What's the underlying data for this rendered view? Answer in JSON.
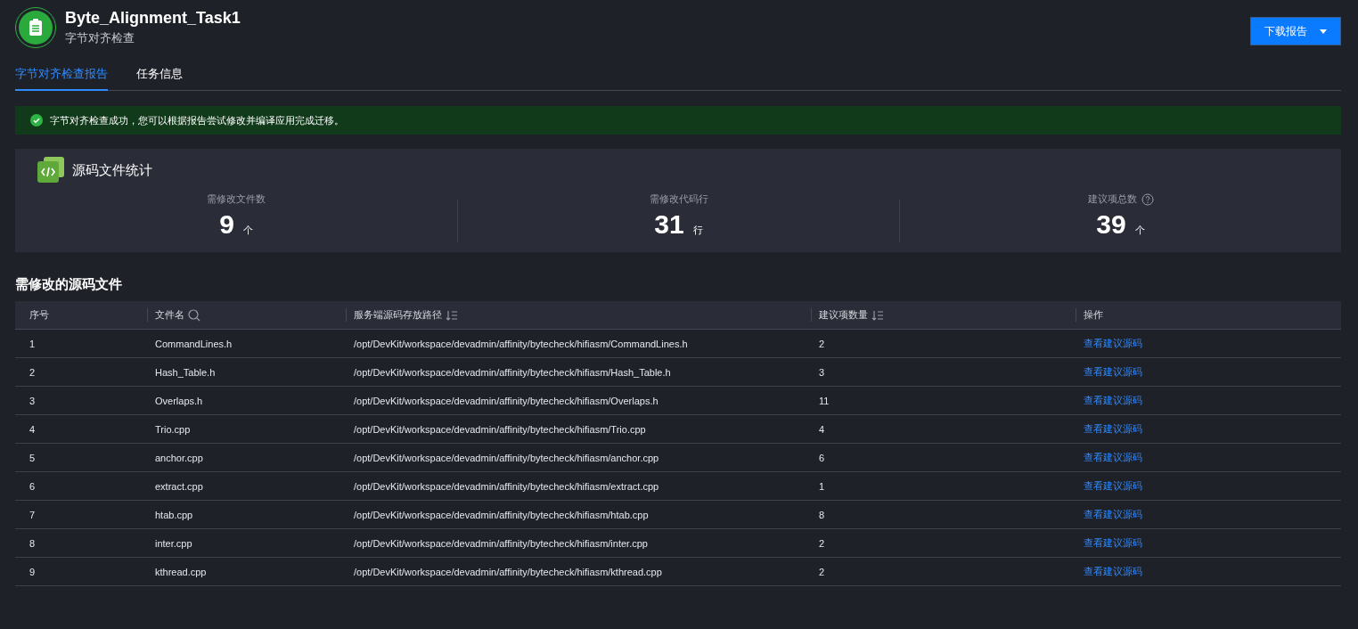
{
  "header": {
    "title": "Byte_Alignment_Task1",
    "subtitle": "字节对齐检查",
    "download_button": "下载报告"
  },
  "tabs": [
    {
      "label": "字节对齐检查报告",
      "selected": true
    },
    {
      "label": "任务信息",
      "selected": false
    }
  ],
  "alert": {
    "message": "字节对齐检查成功，您可以根据报告尝试修改并编译应用完成迁移。"
  },
  "stats": {
    "title": "源码文件统计",
    "items": [
      {
        "label": "需修改文件数",
        "value": "9",
        "unit": "个",
        "help": false
      },
      {
        "label": "需修改代码行",
        "value": "31",
        "unit": "行",
        "help": false
      },
      {
        "label": "建议项总数",
        "value": "39",
        "unit": "个",
        "help": true
      }
    ]
  },
  "files": {
    "title": "需修改的源码文件",
    "columns": [
      {
        "label": "序号",
        "kind": "plain"
      },
      {
        "label": "文件名",
        "kind": "search"
      },
      {
        "label": "服务端源码存放路径",
        "kind": "sort"
      },
      {
        "label": "建议项数量",
        "kind": "sort"
      },
      {
        "label": "操作",
        "kind": "plain"
      }
    ],
    "rows": [
      {
        "index": "1",
        "name": "CommandLines.h",
        "path": "/opt/DevKit/workspace/devadmin/affinity/bytecheck/hifiasm/CommandLines.h",
        "count": "2",
        "action": "查看建议源码"
      },
      {
        "index": "2",
        "name": "Hash_Table.h",
        "path": "/opt/DevKit/workspace/devadmin/affinity/bytecheck/hifiasm/Hash_Table.h",
        "count": "3",
        "action": "查看建议源码"
      },
      {
        "index": "3",
        "name": "Overlaps.h",
        "path": "/opt/DevKit/workspace/devadmin/affinity/bytecheck/hifiasm/Overlaps.h",
        "count": "11",
        "action": "查看建议源码"
      },
      {
        "index": "4",
        "name": "Trio.cpp",
        "path": "/opt/DevKit/workspace/devadmin/affinity/bytecheck/hifiasm/Trio.cpp",
        "count": "4",
        "action": "查看建议源码"
      },
      {
        "index": "5",
        "name": "anchor.cpp",
        "path": "/opt/DevKit/workspace/devadmin/affinity/bytecheck/hifiasm/anchor.cpp",
        "count": "6",
        "action": "查看建议源码"
      },
      {
        "index": "6",
        "name": "extract.cpp",
        "path": "/opt/DevKit/workspace/devadmin/affinity/bytecheck/hifiasm/extract.cpp",
        "count": "1",
        "action": "查看建议源码"
      },
      {
        "index": "7",
        "name": "htab.cpp",
        "path": "/opt/DevKit/workspace/devadmin/affinity/bytecheck/hifiasm/htab.cpp",
        "count": "8",
        "action": "查看建议源码"
      },
      {
        "index": "8",
        "name": "inter.cpp",
        "path": "/opt/DevKit/workspace/devadmin/affinity/bytecheck/hifiasm/inter.cpp",
        "count": "2",
        "action": "查看建议源码"
      },
      {
        "index": "9",
        "name": "kthread.cpp",
        "path": "/opt/DevKit/workspace/devadmin/affinity/bytecheck/hifiasm/kthread.cpp",
        "count": "2",
        "action": "查看建议源码"
      }
    ]
  }
}
